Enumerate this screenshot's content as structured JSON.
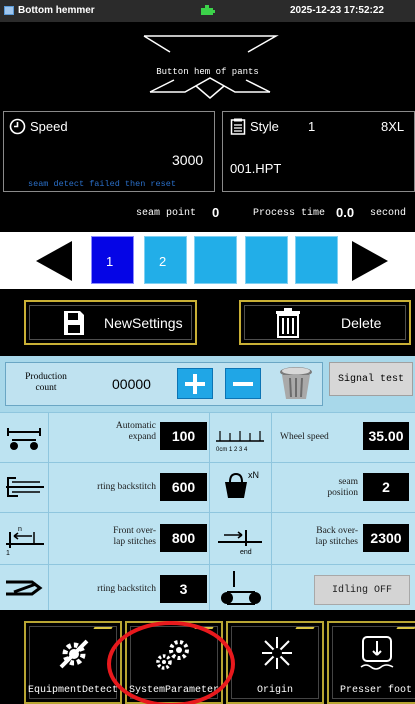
{
  "title_bar": {
    "app_title": "Bottom hemmer",
    "datetime": "2025-12-23 17:52:22",
    "icons": [
      "app-window-icon",
      "battery-icon"
    ]
  },
  "header": {
    "machine_title": "Button hem of pants",
    "icons": [
      "hem-diagram-icon"
    ]
  },
  "speed_panel": {
    "label": "Speed",
    "value": "3000",
    "message": "seam detect failed then reset",
    "icon": "clock-icon"
  },
  "style_panel": {
    "label": "Style",
    "number": "1",
    "size": "8XL",
    "file": "001.HPT",
    "icon": "document-icon"
  },
  "status_row": {
    "seam_point_label": "seam point",
    "seam_point_value": "0",
    "process_time_label": "Process time",
    "process_time_value": "0.0",
    "process_time_unit": "second"
  },
  "pages": {
    "items": [
      "1",
      "2",
      "",
      "",
      "",
      ""
    ],
    "active_index": 0,
    "icons": [
      "arrow-left-icon",
      "arrow-right-icon"
    ]
  },
  "actions": {
    "new_settings": "NewSettings",
    "delete": "Delete",
    "icons": [
      "save-icon",
      "trash-icon"
    ]
  },
  "production": {
    "label_line1": "Production",
    "label_line2": "count",
    "value": "00000",
    "signal_test": "Signal test",
    "icons": [
      "plus-icon",
      "minus-icon",
      "trash-bin-icon"
    ]
  },
  "params": {
    "automatic_expand": {
      "line1": "Automatic",
      "line2": "expand",
      "value": "100"
    },
    "wheel_speed": {
      "label": "Wheel speed",
      "value": "35.00"
    },
    "starting_backstitch": {
      "label": "rting backstitch",
      "value": "600"
    },
    "seam_position": {
      "line1": "seam",
      "line2": "position",
      "value": "2"
    },
    "front_overlap": {
      "line1": "Front over-",
      "line2": "lap stitches",
      "value": "800"
    },
    "back_overlap": {
      "line1": "Back over-",
      "line2": "lap stitches",
      "value": "2300"
    },
    "ending_backstitch": {
      "label": "rting backstitch",
      "value": "3"
    },
    "idling": "Idling OFF",
    "ruler_ticks": "0cm 1  2  3  4",
    "xn_label": "xN",
    "n_label": "n",
    "one_label": "1",
    "end_label": "end"
  },
  "toolbar": {
    "equipment_detect": "EquipmentDetect",
    "system_parameter": "SystemParameter",
    "origin": "Origin",
    "presser_foot": "Presser foot",
    "highlight_color": "#e8191d"
  }
}
